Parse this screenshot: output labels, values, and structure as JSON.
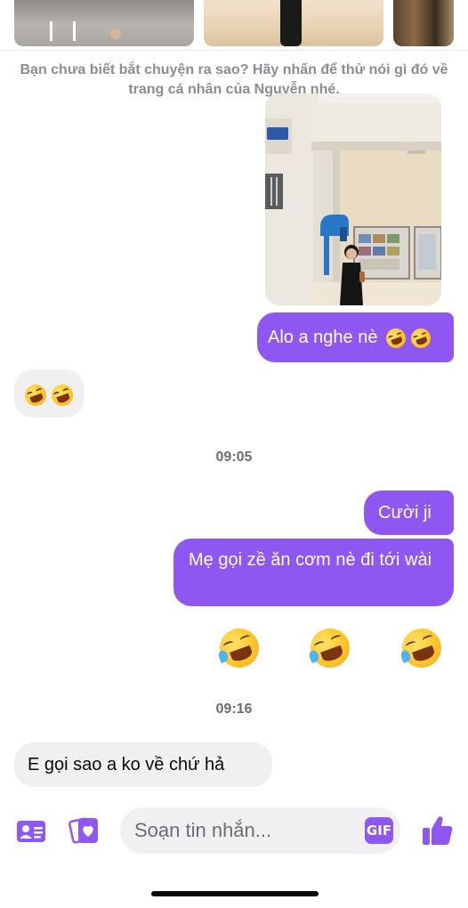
{
  "suggestion_text": "Bạn chưa biết bắt chuyện ra sao? Hãy nhấn để thử nói gì đó về trang cá nhân của Nguyễn nhé.",
  "messages": {
    "m1_text": "Alo a nghe nè",
    "time_1": "09:05",
    "m3_text": "Cười ji",
    "m4_text": "Mẹ gọi zề ăn cơm nè đi tới wài",
    "time_2": "09:16",
    "m6_text": "E gọi sao a ko về chứ hả"
  },
  "composer": {
    "placeholder": "Soạn tin nhắn...",
    "gif_label": "GIF"
  },
  "colors": {
    "accent": "#8e57f2",
    "incoming_bubble": "#f0f0f0",
    "outgoing_text": "#ffffff"
  },
  "icons": {
    "contact_card": "contact-card-icon",
    "sticker": "sticker-icon",
    "gif": "gif-icon",
    "like": "thumbs-up-icon",
    "emoji": "rolling-on-floor-laughing-emoji"
  }
}
